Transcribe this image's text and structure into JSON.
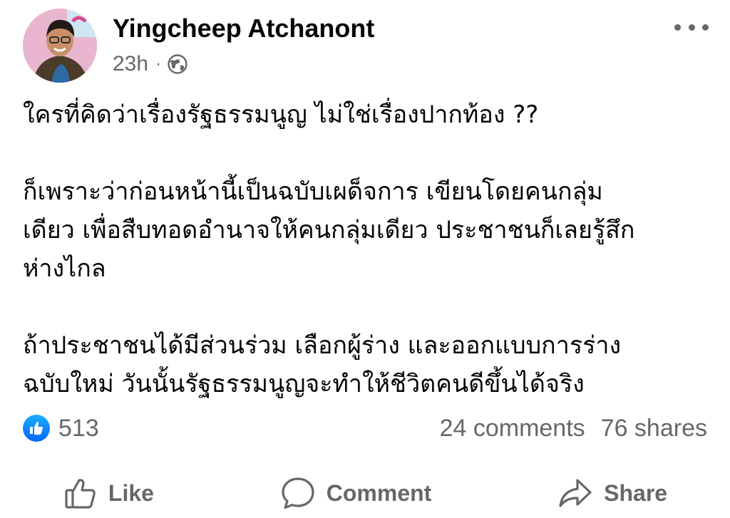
{
  "post": {
    "author_name": "Yingcheep Atchanont",
    "time": "23h",
    "separator": "·",
    "privacy_icon": "globe-icon",
    "more_icon": "more-horizontal-icon",
    "paragraphs": [
      [
        "ใครที่คิดว่าเรื่องรัฐธรรมนูญ ไม่ใช่เรื่องปากท้อง ??"
      ],
      [
        "ก็เพราะว่าก่อนหน้านี้เป็นฉบับเผด็จการ เขียนโดยคนกลุ่ม",
        "เดียว เพื่อสืบทอดอำนาจให้คนกลุ่มเดียว ประชาชนก็เลยรู้สึก",
        "ห่างไกล"
      ],
      [
        "ถ้าประชาชนได้มีส่วนร่วม เลือกผู้ร่าง และออกแบบการร่าง",
        "ฉบับใหม่ วันนั้นรัฐธรรมนูญจะทำให้ชีวิตคนดีขึ้นได้จริง"
      ]
    ]
  },
  "stats": {
    "like_count": "513",
    "comments": "24 comments",
    "shares": "76 shares",
    "like_badge_color": "#0866ff"
  },
  "actions": {
    "like_label": "Like",
    "comment_label": "Comment",
    "share_label": "Share"
  },
  "colors": {
    "primary_text": "#050505",
    "secondary_text": "#65676b",
    "accent_blue": "#0866ff"
  }
}
